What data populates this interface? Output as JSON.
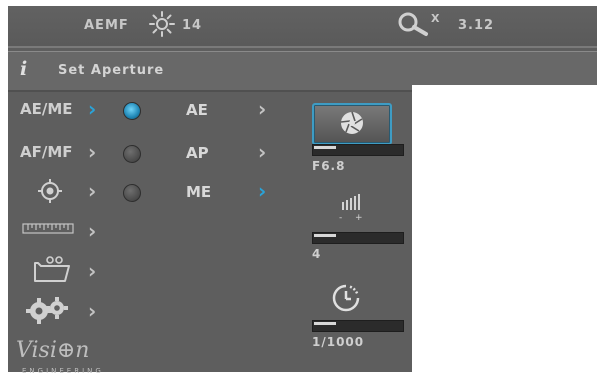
{
  "header": {
    "mode_label": "AEMF",
    "brightness_value": "14",
    "zoom_x": "X",
    "zoom_value": "3.12"
  },
  "info": {
    "icon": "i",
    "title": "Set Aperture"
  },
  "menu": {
    "items": [
      {
        "label": "AE/ME"
      },
      {
        "label": "AF/MF"
      },
      {
        "label": "target-icon"
      },
      {
        "label": "ruler-icon"
      },
      {
        "label": "folder-icon"
      },
      {
        "label": "gears-icon"
      }
    ]
  },
  "modes": [
    {
      "label": "AE",
      "selected": true
    },
    {
      "label": "AP",
      "selected": false
    },
    {
      "label": "ME",
      "selected": false
    }
  ],
  "controls": {
    "aperture": {
      "value": "F6.8",
      "level": 0.25
    },
    "exposure": {
      "value": "4",
      "level": 0.25
    },
    "shutter": {
      "value": "1/1000",
      "level": 0.25
    }
  },
  "logo": {
    "main": "Visi⊕n",
    "sub": "ENGINEERING"
  },
  "colors": {
    "accent": "#2aa3d8",
    "panel": "#5e5e5e"
  }
}
